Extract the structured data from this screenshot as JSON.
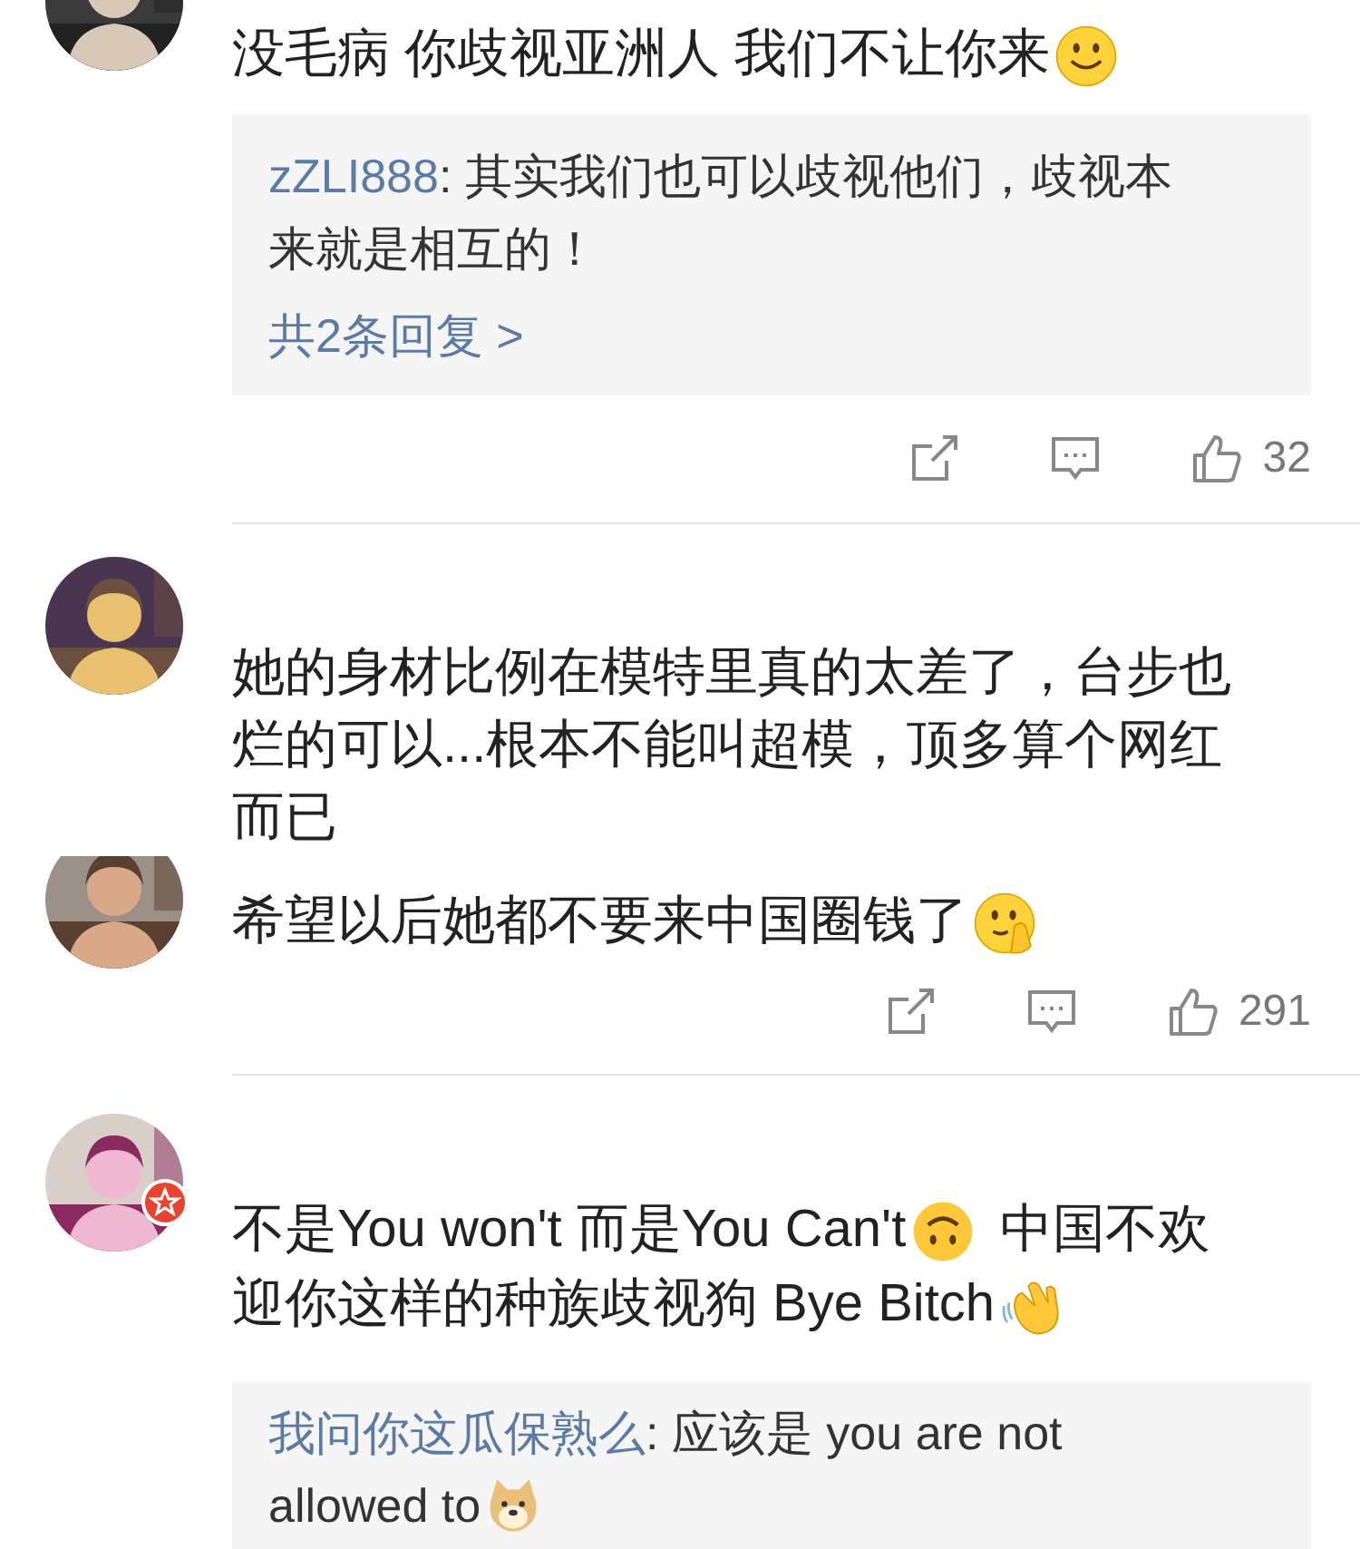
{
  "comments": [
    {
      "avatar": {
        "kind": "picture"
      },
      "lines": [
        [
          {
            "kind": "text",
            "text": "没毛病 你歧视亚洲人 我们不让你来"
          },
          {
            "kind": "smile"
          }
        ]
      ],
      "reply": {
        "user": "zZLI888",
        "lines": [
          [
            {
              "kind": "text",
              "text": ": 其实我们也可以歧视他们，歧视本"
            }
          ],
          [
            {
              "kind": "text",
              "text": "来就是相互的！"
            }
          ]
        ],
        "more": "共2条回复 >"
      },
      "actions": {
        "likes": "32"
      }
    },
    {
      "avatar": {
        "kind": "picture"
      },
      "lines": [
        [
          {
            "kind": "text",
            "text": "她的身材比例在模特里真的太差了，台步也"
          }
        ],
        [
          {
            "kind": "text",
            "text": "烂的可以...根本不能叫超模，顶多算个网红"
          }
        ],
        [
          {
            "kind": "text",
            "text": "而已"
          }
        ]
      ]
    },
    {
      "avatar": {
        "kind": "picture"
      },
      "lines": [
        [
          {
            "kind": "text",
            "text": "希望以后她都不要来中国圈钱了"
          },
          {
            "kind": "shy"
          }
        ]
      ],
      "actions": {
        "likes": "291"
      }
    },
    {
      "avatar": {
        "kind": "picture"
      },
      "verified": true,
      "lines": [
        [
          {
            "kind": "text",
            "text": "不是You won't 而是You Can't"
          },
          {
            "kind": "upside-down"
          },
          {
            "kind": "text",
            "text": "中国不欢"
          }
        ],
        [
          {
            "kind": "text",
            "text": "迎你这样的种族歧视狗 Bye Bitch"
          },
          {
            "kind": "wave"
          }
        ]
      ],
      "reply": {
        "user": "我问你这瓜保熟么",
        "lines": [
          [
            {
              "kind": "text",
              "text": ": 应该是 you are not"
            }
          ],
          [
            {
              "kind": "text",
              "text": "allowed to"
            },
            {
              "kind": "doge"
            }
          ]
        ]
      }
    }
  ]
}
